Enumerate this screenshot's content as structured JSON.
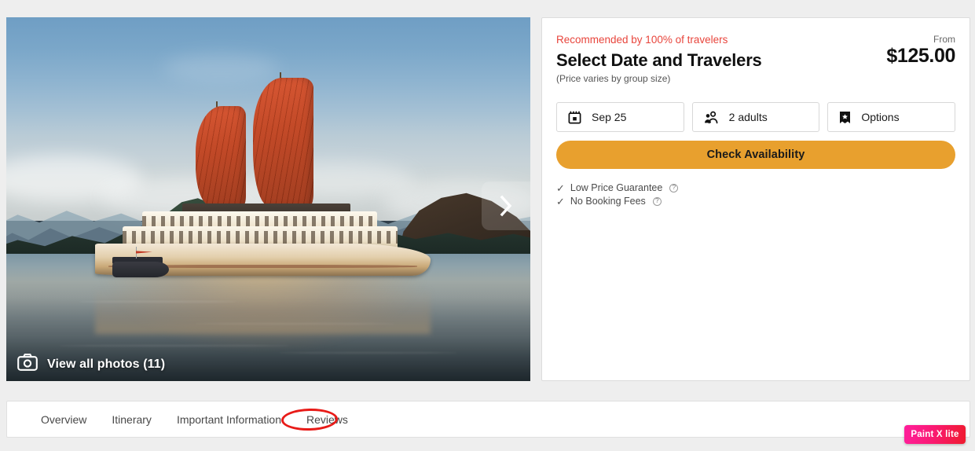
{
  "gallery": {
    "next_arrow_icon": "chevron-right-icon",
    "view_all_photos_label": "View all photos (11)",
    "camera_icon": "camera-icon",
    "photo_alt": "Wooden junk boat with red sails at sunset in Ha Long Bay",
    "photo_count": 11
  },
  "booking": {
    "recommendation": "Recommended by 100% of travelers",
    "title": "Select Date and Travelers",
    "subtitle": "(Price varies by group size)",
    "price_from_label": "From",
    "price_amount": "$125.00",
    "selectors": [
      {
        "icon": "calendar-icon",
        "label": "Sep 25",
        "name": "date-selector"
      },
      {
        "icon": "travelers-icon",
        "label": "2 adults",
        "name": "travelers-selector"
      },
      {
        "icon": "ticket-icon",
        "label": "Options",
        "name": "options-selector"
      }
    ],
    "cta_label": "Check Availability",
    "perks": [
      {
        "label": "Low Price Guarantee",
        "info_icon": "info-icon"
      },
      {
        "label": "No Booking Fees",
        "info_icon": "info-icon"
      }
    ],
    "check_glyph": "✓",
    "info_glyph": "?"
  },
  "tabs": {
    "items": [
      {
        "label": "Overview",
        "name": "tab-overview"
      },
      {
        "label": "Itinerary",
        "name": "tab-itinerary"
      },
      {
        "label": "Important Information",
        "name": "tab-important-information"
      },
      {
        "label": "Reviews",
        "name": "tab-reviews"
      }
    ],
    "annotated_tab": "Reviews"
  },
  "watermark": {
    "label": "Paint X lite"
  },
  "colors": {
    "page_background": "#eeeeee",
    "card_background": "#ffffff",
    "recommendation_red": "#e8453c",
    "cta_orange": "#e8a02e",
    "annotation_red": "#e81b18",
    "watermark_gradient_start": "#ff1f9c",
    "watermark_gradient_end": "#ef1b2e",
    "text_primary": "#111111",
    "text_secondary": "#555555"
  }
}
